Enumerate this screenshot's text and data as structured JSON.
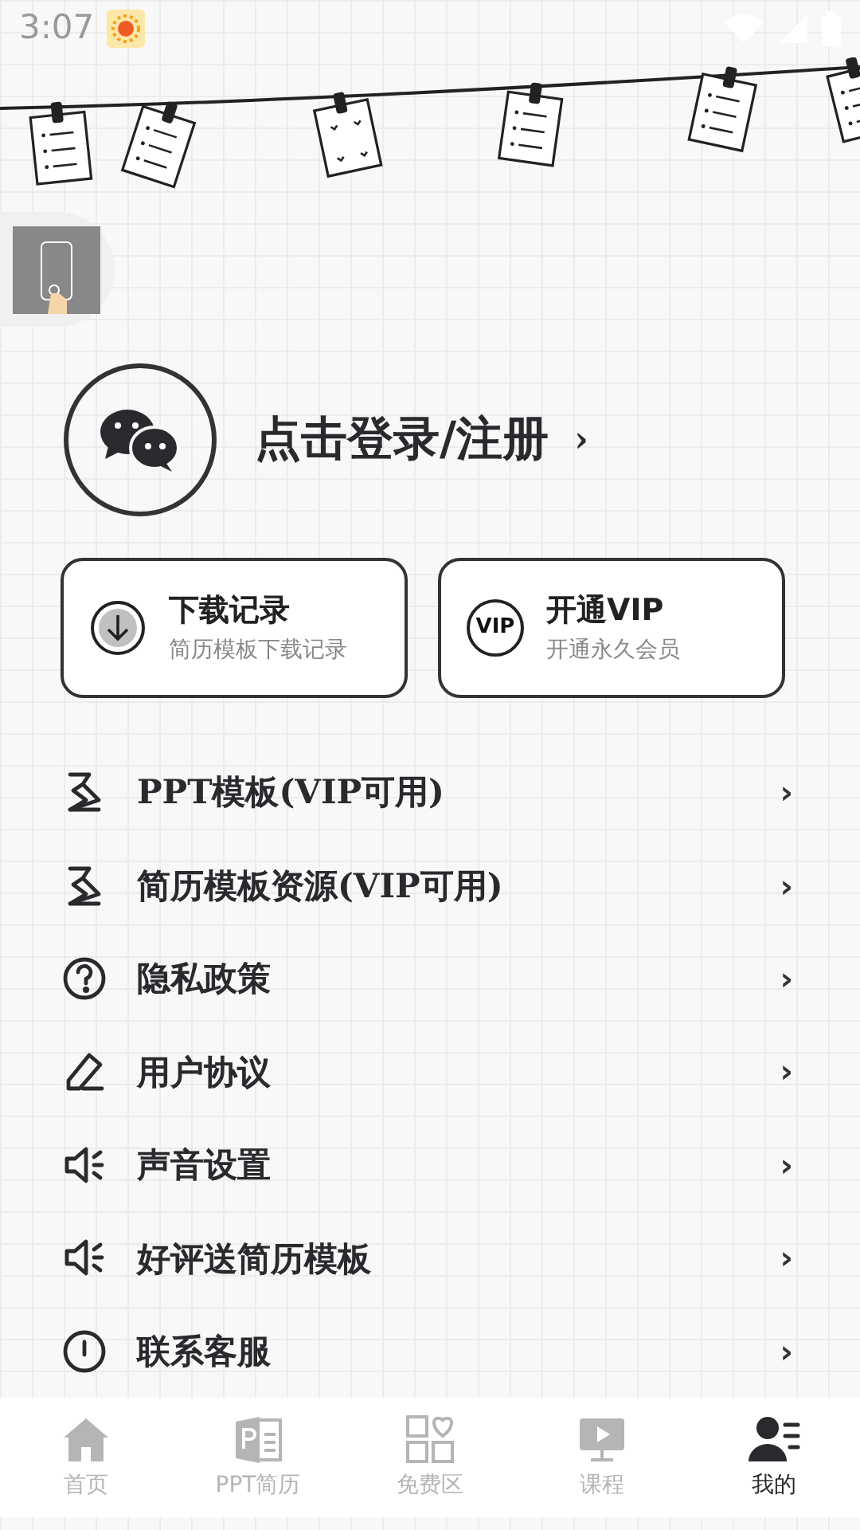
{
  "status_bar": {
    "time": "3:07"
  },
  "profile": {
    "login_label": "点击登录/注册",
    "arrow": "›"
  },
  "cards": [
    {
      "title": "下载记录",
      "subtitle": "简历模板下载记录",
      "kind": "download"
    },
    {
      "title": "开通VIP",
      "subtitle": "开通永久会员",
      "kind": "vip",
      "badge": "VIP"
    }
  ],
  "menu": [
    {
      "label": "PPT模板(VIP可用)",
      "kind": "hanger",
      "arrow": "›"
    },
    {
      "label": "简历模板资源(VIP可用)",
      "kind": "hanger",
      "arrow": "›"
    },
    {
      "label": "隐私政策",
      "kind": "question",
      "arrow": "›"
    },
    {
      "label": "用户协议",
      "kind": "pencil",
      "arrow": "›"
    },
    {
      "label": "声音设置",
      "kind": "speaker",
      "arrow": "›"
    },
    {
      "label": "好评送简历模板",
      "kind": "speaker",
      "arrow": "›"
    },
    {
      "label": "联系客服",
      "kind": "info",
      "arrow": "›"
    }
  ],
  "tabs": [
    {
      "label": "首页",
      "kind": "home",
      "selected": false
    },
    {
      "label": "PPT简历",
      "kind": "ppt",
      "selected": false
    },
    {
      "label": "免费区",
      "kind": "grid",
      "selected": false
    },
    {
      "label": "课程",
      "kind": "video",
      "selected": false
    },
    {
      "label": "我的",
      "kind": "user",
      "selected": true
    }
  ]
}
